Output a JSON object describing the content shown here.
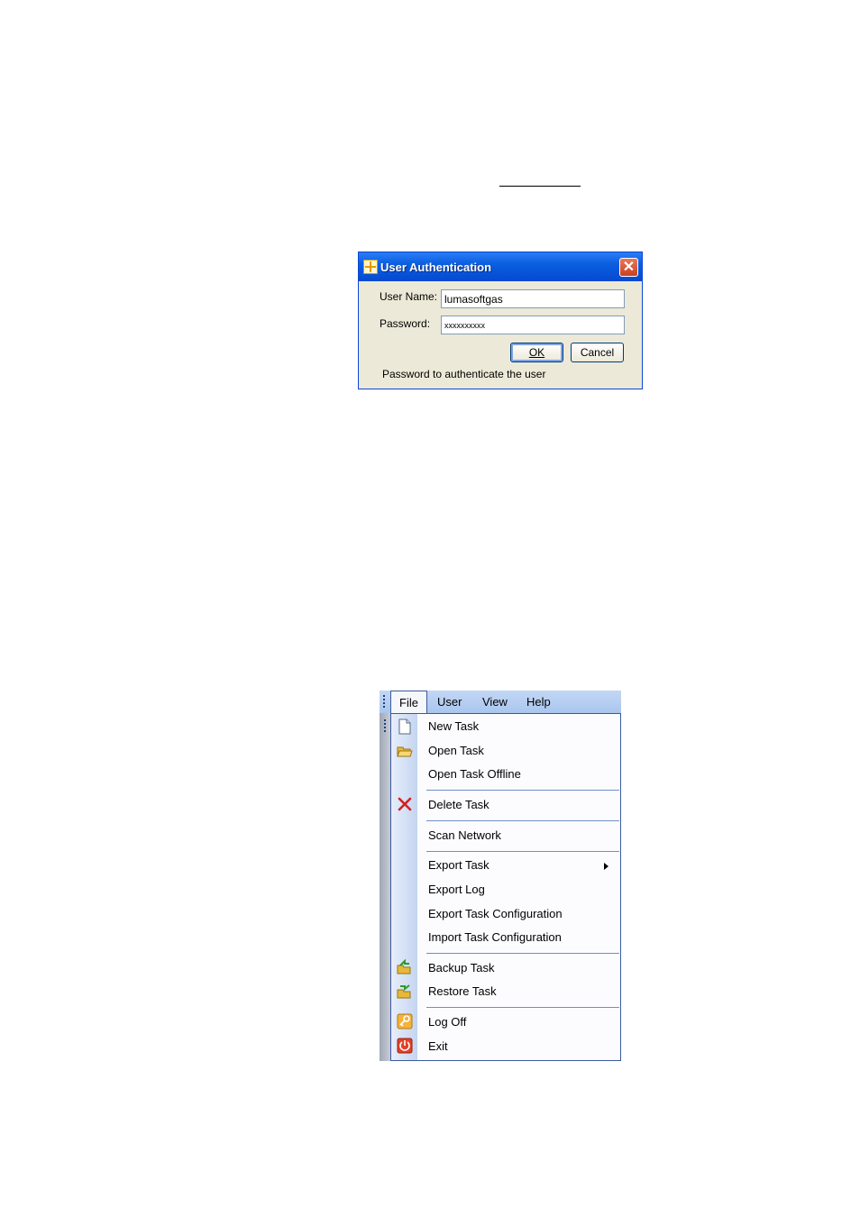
{
  "dialog": {
    "title": "User Authentication",
    "close_glyph": "✕",
    "username_label": "User Name:",
    "username_value": "lumasoftgas",
    "password_label": "Password:",
    "password_value": "xxxxxxxxxx",
    "ok_label": "OK",
    "cancel_label": "Cancel",
    "status": "Password to authenticate the user"
  },
  "menubar": {
    "items": [
      "File",
      "User",
      "View",
      "Help"
    ]
  },
  "file_menu": {
    "items": [
      {
        "label": "New Task",
        "icon": "new-task-icon"
      },
      {
        "label": "Open Task",
        "icon": "folder-open-icon"
      },
      {
        "label": "Open Task Offline"
      },
      {
        "label": "Delete Task",
        "icon": "delete-x-icon"
      },
      {
        "label": "Scan Network"
      },
      {
        "label": "Export Task",
        "submenu": true
      },
      {
        "label": "Export Log"
      },
      {
        "label": "Export Task Configuration"
      },
      {
        "label": "Import Task Configuration"
      },
      {
        "label": "Backup Task",
        "icon": "backup-folder-icon"
      },
      {
        "label": "Restore Task",
        "icon": "restore-folder-icon"
      },
      {
        "label": "Log Off",
        "icon": "key-icon"
      },
      {
        "label": "Exit",
        "icon": "power-icon"
      }
    ]
  },
  "colors": {
    "titlebar": "#0a5fe0",
    "dialog_bg": "#ece9d8",
    "menubar": "#a9c6ee",
    "separator": "#6f8fc5",
    "delete_red": "#d42020"
  }
}
